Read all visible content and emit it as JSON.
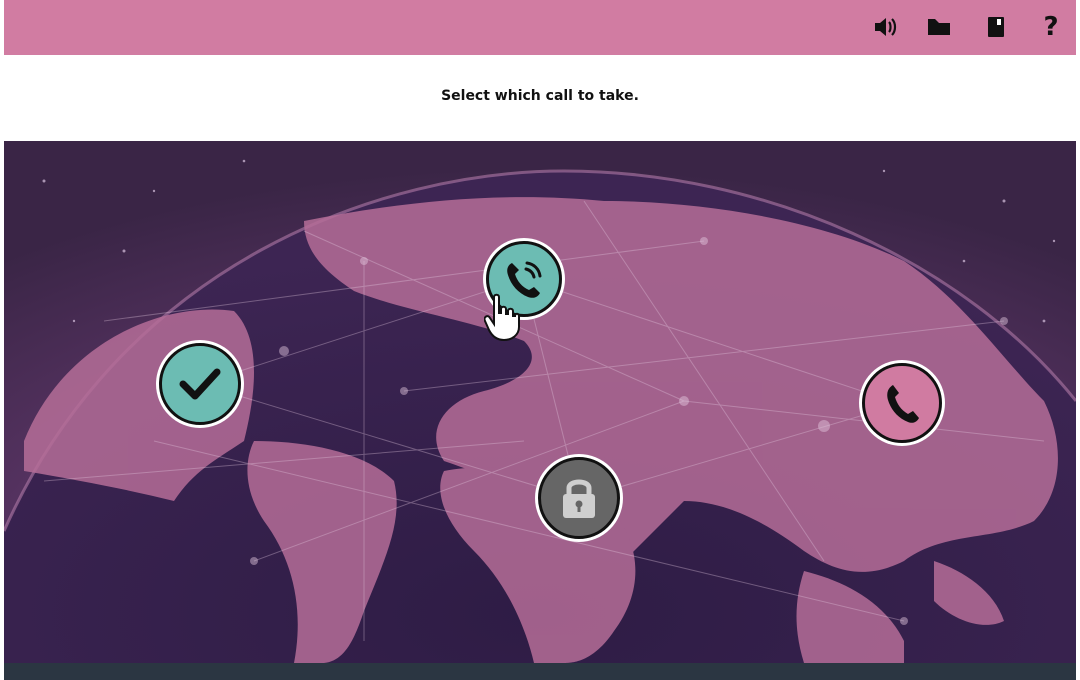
{
  "toolbar": {
    "icons": [
      "sound-icon",
      "folder-icon",
      "notebook-icon",
      "help-icon"
    ],
    "help_label": "?"
  },
  "instruction": "Select which call to take.",
  "map": {
    "calls": [
      {
        "id": "americas",
        "state": "completed",
        "icon": "checkmark-icon"
      },
      {
        "id": "europe",
        "state": "ringing",
        "icon": "ringing-phone-icon"
      },
      {
        "id": "asia",
        "state": "available",
        "icon": "phone-icon"
      },
      {
        "id": "africa",
        "state": "locked",
        "icon": "lock-icon"
      }
    ]
  },
  "colors": {
    "topbar": "#d17ca2",
    "teal": "#6cbcb3",
    "pink": "#d07ba1",
    "locked": "#666666",
    "bottombar": "#2b3642"
  }
}
